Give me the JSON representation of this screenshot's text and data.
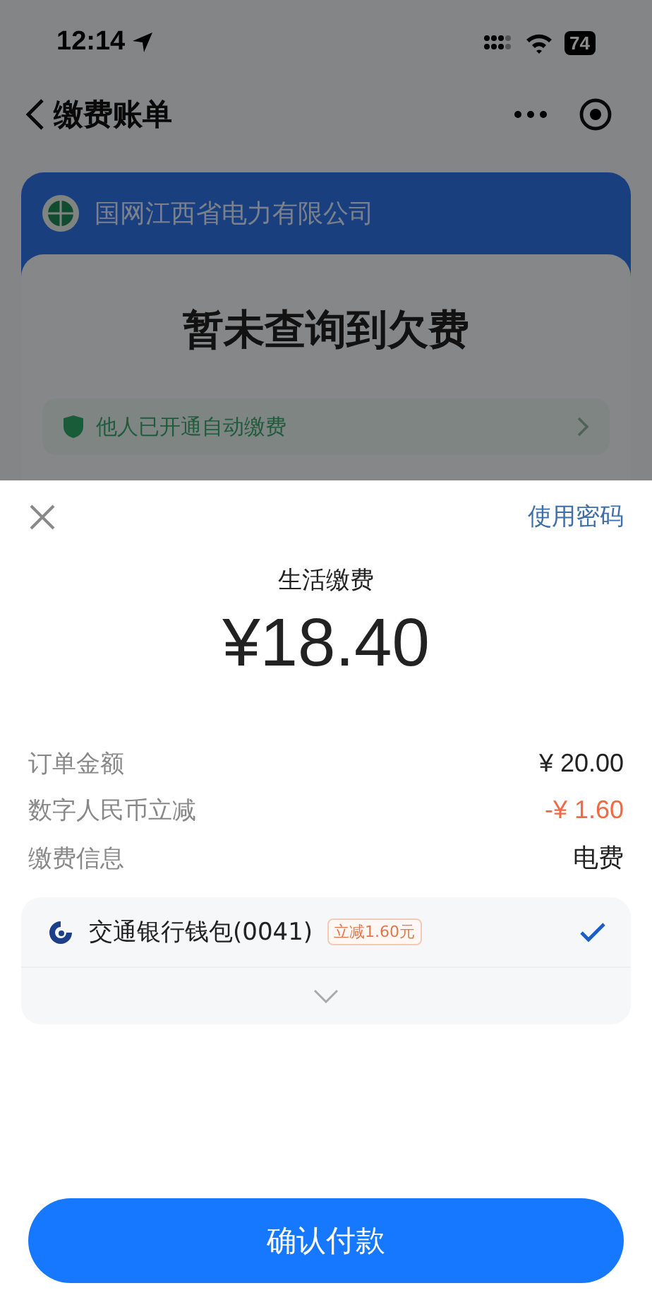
{
  "status_bar": {
    "time": "12:14",
    "battery": "74"
  },
  "nav": {
    "title": "缴费账单"
  },
  "bill_card": {
    "company": "国网江西省电力有限公司",
    "headline": "暂未查询到欠费",
    "notice": "他人已开通自动缴费"
  },
  "payment_sheet": {
    "password_link": "使用密码",
    "title": "生活缴费",
    "amount": "¥18.40",
    "details": [
      {
        "label": "订单金额",
        "value": "¥ 20.00",
        "kind": "normal"
      },
      {
        "label": "数字人民币立减",
        "value": "-¥ 1.60",
        "kind": "discount"
      },
      {
        "label": "缴费信息",
        "value": "电费",
        "kind": "normal"
      }
    ],
    "methods": [
      {
        "name": "交通银行钱包(0041)",
        "badge": "立减1.60元",
        "selected": true
      }
    ],
    "confirm_button": "确认付款"
  }
}
